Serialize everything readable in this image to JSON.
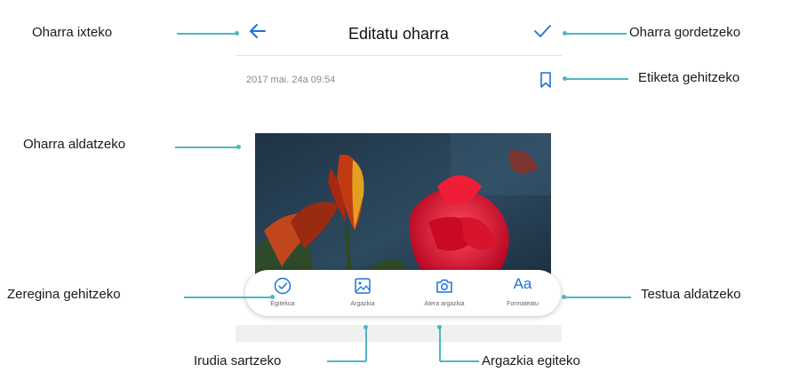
{
  "header": {
    "title": "Editatu oharra"
  },
  "note": {
    "date": "2017 mai. 24a 09:54"
  },
  "toolbar": {
    "items": [
      {
        "label": "Egitekoa",
        "icon": "checklist-icon"
      },
      {
        "label": "Argazkia",
        "icon": "image-icon"
      },
      {
        "label": "Atera argazkia",
        "icon": "camera-icon"
      },
      {
        "label": "Formateatu",
        "icon": "text-format-icon",
        "glyph": "Aa"
      }
    ]
  },
  "annotations": {
    "close": "Oharra ixteko",
    "save": "Oharra gordetzeko",
    "tag": "Etiketa gehitzeko",
    "edit": "Oharra aldatzeko",
    "task": "Zeregina gehitzeko",
    "text": "Testua aldatzeko",
    "insert_image": "Irudia sartzeko",
    "take_photo": "Argazkia egiteko"
  },
  "colors": {
    "accent": "#1a73d9",
    "callout_line": "#4cb8c4",
    "photo_background": "#253a4c",
    "flower_red": "#e0102c"
  }
}
